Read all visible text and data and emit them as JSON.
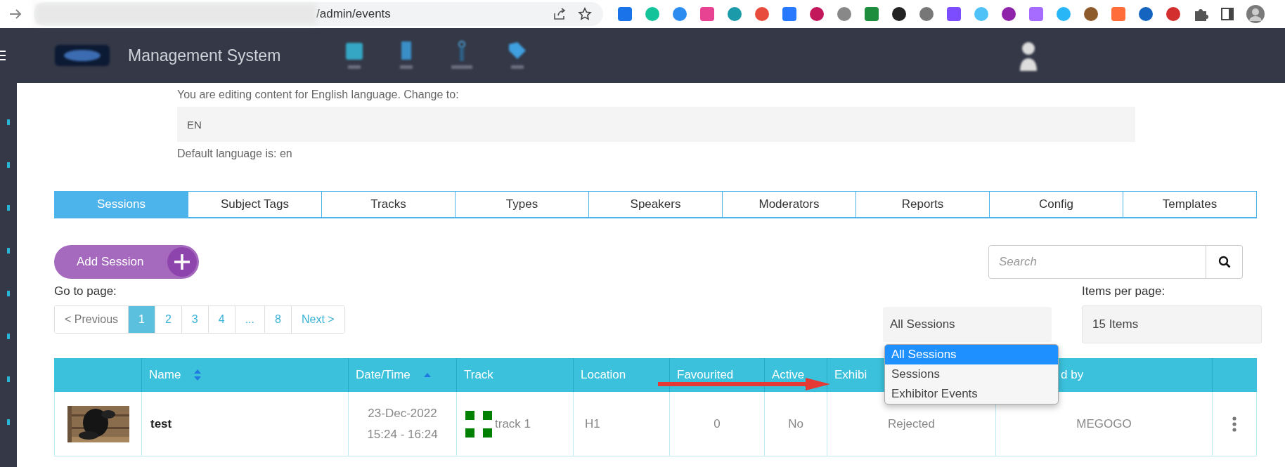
{
  "browser": {
    "url": "/admin/events"
  },
  "header": {
    "title": "Management System"
  },
  "language": {
    "notice": "You are editing content for English language. Change to:",
    "value": "EN",
    "default_note": "Default language is: en"
  },
  "tabs": [
    {
      "label": "Sessions",
      "selected": true
    },
    {
      "label": "Subject Tags",
      "selected": false
    },
    {
      "label": "Tracks",
      "selected": false
    },
    {
      "label": "Types",
      "selected": false
    },
    {
      "label": "Speakers",
      "selected": false
    },
    {
      "label": "Moderators",
      "selected": false
    },
    {
      "label": "Reports",
      "selected": false
    },
    {
      "label": "Config",
      "selected": false
    },
    {
      "label": "Templates",
      "selected": false
    }
  ],
  "add_button": "Add Session",
  "search": {
    "placeholder": "Search"
  },
  "pagination": {
    "label": "Go to page:",
    "pages": [
      {
        "label": "< Previous",
        "selected": false
      },
      {
        "label": "1",
        "selected": true
      },
      {
        "label": "2",
        "selected": false
      },
      {
        "label": "3",
        "selected": false
      },
      {
        "label": "4",
        "selected": false
      },
      {
        "label": "...",
        "selected": false
      },
      {
        "label": "8",
        "selected": false
      },
      {
        "label": "Next >",
        "selected": false
      }
    ]
  },
  "filter": {
    "value": "All Sessions",
    "options": [
      {
        "label": "All Sessions",
        "selected": true
      },
      {
        "label": "Sessions",
        "selected": false
      },
      {
        "label": "Exhibitor Events",
        "selected": false
      }
    ]
  },
  "items_per_page": {
    "label": "Items per page:",
    "value": "15 Items"
  },
  "table": {
    "columns": [
      {
        "label": "Name",
        "sortable": true,
        "sorted_ascending": false
      },
      {
        "label": "Date/Time",
        "sorted_ascending": true
      },
      {
        "label": "Track"
      },
      {
        "label": "Location"
      },
      {
        "label": "Favourited"
      },
      {
        "label": "Active"
      },
      {
        "label": "Exhibi"
      },
      {
        "label": "d by"
      }
    ],
    "rows": [
      {
        "name": "test",
        "date": "23-Dec-2022",
        "time": "15:24 - 16:24",
        "track": {
          "label": "track 1",
          "color": "#008000"
        },
        "location": "H1",
        "favourited": "0",
        "active": "No",
        "status": "Rejected",
        "by": "MEGOGO"
      }
    ]
  }
}
